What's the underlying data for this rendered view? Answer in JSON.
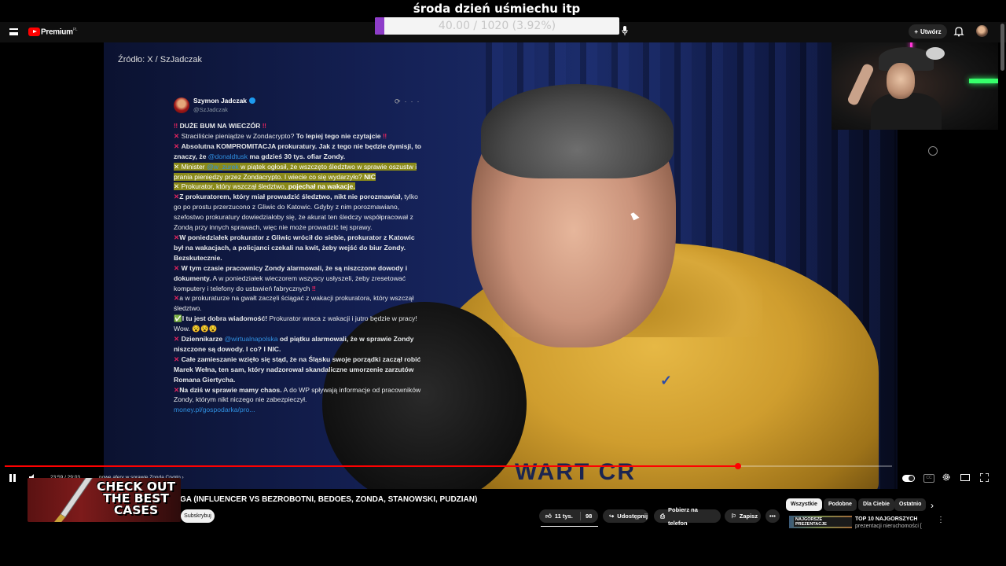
{
  "stream_overlay": {
    "title": "środa dzień uśmiechu itp",
    "goal_text": "40.00 / 1020 (3.92%)",
    "goal_fraction": 0.0392,
    "goal_color": "#8e3dc9"
  },
  "header": {
    "logo_text": "Premium",
    "logo_region": "PL",
    "create_label": "Utwórz",
    "icons": [
      "menu-icon",
      "youtube-logo",
      "mic-icon",
      "plus-icon",
      "bell-icon",
      "avatar"
    ]
  },
  "video": {
    "source_label": "Źródło: X / SzJadczak",
    "tweet": {
      "author": "Szymon Jadczak",
      "handle": "@SzJadczak",
      "link": "money.pl/gospodarka/pro..."
    }
  },
  "player": {
    "time": "23:59 / 29:03",
    "chapter": "nowe afery w sprawie Zonda Crypto",
    "progress_fraction": 0.826,
    "progress_color": "#ff0000"
  },
  "below": {
    "video_title": "GA (INFLUENCER VS BEZROBOTNI, BEDOES, ZONDA, STANOWSKI, PUDZIAN)",
    "subscribe_label": "Subskrybuj",
    "like_count": "11 tys.",
    "dislike_count": "98",
    "share_label": "Udostępnij",
    "download_label": "Pobierz na telefon",
    "save_label": "Zapisz",
    "more_label": "•••",
    "chips": [
      "Wszystkie",
      "Podobne",
      "Dla Ciebie",
      "Ostatnio"
    ],
    "rec_thumb_label": "NAJGORSZE PREZENTACJE",
    "rec_title": "TOP 10 NAJGORSZYCH",
    "rec_sub": "prezentacji nieruchomości ["
  },
  "banner": {
    "line1": "CHECK OUT",
    "line2": "THE BEST",
    "line3": "CASES"
  }
}
